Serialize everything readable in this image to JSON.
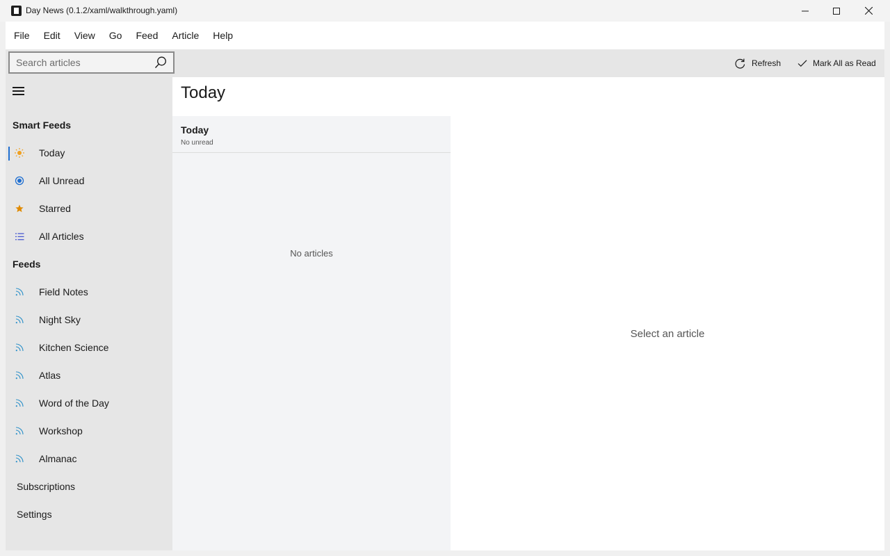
{
  "window": {
    "title": "Day News (0.1.2/xaml/walkthrough.yaml)"
  },
  "menu": {
    "items": [
      {
        "label": "File"
      },
      {
        "label": "Edit"
      },
      {
        "label": "View"
      },
      {
        "label": "Go"
      },
      {
        "label": "Feed"
      },
      {
        "label": "Article"
      },
      {
        "label": "Help"
      }
    ]
  },
  "search": {
    "placeholder": "Search articles",
    "value": ""
  },
  "toolbar": {
    "refresh_label": "Refresh",
    "mark_all_label": "Mark All as Read"
  },
  "sidebar": {
    "smart_feeds_header": "Smart Feeds",
    "smart_feeds": [
      {
        "label": "Today",
        "icon": "sun-icon",
        "color": "#f0a020",
        "selected": true
      },
      {
        "label": "All Unread",
        "icon": "radio-dot-icon",
        "color": "#1f6fd1"
      },
      {
        "label": "Starred",
        "icon": "star-icon",
        "color": "#e08a00"
      },
      {
        "label": "All Articles",
        "icon": "list-icon",
        "color": "#4a5ad0"
      }
    ],
    "feeds_header": "Feeds",
    "feeds": [
      {
        "label": "Field Notes",
        "icon": "rss-icon"
      },
      {
        "label": "Night Sky",
        "icon": "rss-icon"
      },
      {
        "label": "Kitchen Science",
        "icon": "rss-icon"
      },
      {
        "label": "Atlas",
        "icon": "rss-icon"
      },
      {
        "label": "Word of the Day",
        "icon": "rss-icon"
      },
      {
        "label": "Workshop",
        "icon": "rss-icon"
      },
      {
        "label": "Almanac",
        "icon": "rss-icon"
      }
    ],
    "feed_icon_color": "#2a8fc8",
    "subscriptions_label": "Subscriptions",
    "settings_label": "Settings"
  },
  "main": {
    "page_title": "Today",
    "list_title": "Today",
    "list_subtitle": "No unread",
    "empty_list_text": "No articles",
    "reader_empty_text": "Select an article"
  },
  "colors": {
    "accent": "#1f6fd1"
  }
}
